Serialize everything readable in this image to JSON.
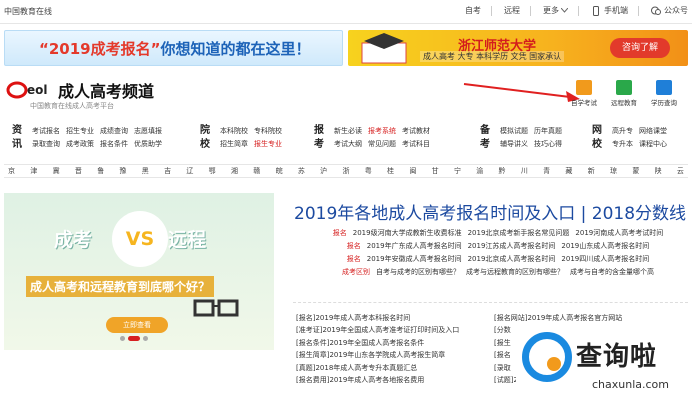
{
  "topbar": {
    "site": "中国教育在线",
    "links": [
      "自考",
      "远程",
      "更多"
    ],
    "mobile": "手机端",
    "wechat": "公众号"
  },
  "banners": {
    "left": {
      "pre": "“2019成考报名”",
      "post": "你想知道的都在这里！"
    },
    "right": {
      "title": "浙江师范大学",
      "sub": "成人高考 大专 本科学历 文凭 国家承认",
      "button": "咨询了解"
    }
  },
  "header": {
    "logo": "eol",
    "title": "成人高考频道",
    "subtitle": "中国教育在线成人高考平台",
    "icons": [
      {
        "label": "自学考试"
      },
      {
        "label": "远程教育"
      },
      {
        "label": "学历查询"
      }
    ]
  },
  "categories": [
    {
      "head": [
        "资",
        "讯"
      ],
      "rows": [
        [
          "考试报名",
          "招生专业",
          "成绩查询",
          "志愿填报"
        ],
        [
          "录取查询",
          "成考政策",
          "报名条件",
          "优质助学"
        ]
      ]
    },
    {
      "head": [
        "院",
        "校"
      ],
      "rows": [
        [
          "本科院校",
          "专科院校"
        ],
        [
          "招生简章",
          "报生专业"
        ]
      ]
    },
    {
      "head": [
        "报",
        "考"
      ],
      "rows": [
        [
          "新生必读",
          "报考系统",
          "考试教材"
        ],
        [
          "考试大纲",
          "常见问题",
          "考试科目"
        ]
      ]
    },
    {
      "head": [
        "备",
        "考"
      ],
      "rows": [
        [
          "模拟试题",
          "历年真题"
        ],
        [
          "辅导讲义",
          "技巧心得"
        ]
      ]
    },
    {
      "head": [
        "网",
        "校"
      ],
      "rows": [
        [
          "高升专",
          "网络课堂"
        ],
        [
          "专升本",
          "课程中心"
        ]
      ]
    }
  ],
  "provinces": [
    "京",
    "津",
    "冀",
    "晋",
    "鲁",
    "豫",
    "黑",
    "吉",
    "辽",
    "鄂",
    "湘",
    "赣",
    "皖",
    "苏",
    "沪",
    "浙",
    "粤",
    "桂",
    "闽",
    "甘",
    "宁",
    "渝",
    "黔",
    "川",
    "青",
    "藏",
    "新",
    "琼",
    "蒙",
    "陕",
    "云"
  ],
  "promo": {
    "a": "成考",
    "vs": "VS",
    "b": "远程",
    "question": "成人高考和远程教育到底哪个好？",
    "button": "立即查看"
  },
  "headline": "2019年各地成人高考报名时间及入口 | 2018分数线",
  "news": [
    [
      "报名",
      "2019级河南大学成教新生收费标准",
      "2019北京成考新手报名常见问题",
      "2019河南成人高考考试时间"
    ],
    [
      "报名",
      "2019年广东成人高考报名时间",
      "2019江苏成人高考报名时间",
      "2019山东成人高考报名时间"
    ],
    [
      "报名",
      "2019年安徽成人高考报名时间",
      "2019北京成人高考报名时间",
      "2019四川成人高考报名时间"
    ],
    [
      "成考区别",
      "自考与成考的区别有哪些？",
      "成考与远程教育的区别有哪些？",
      "成考与自考的含金量哪个高"
    ]
  ],
  "list_left": [
    "[报名]2019年成人高考本科报名时间",
    "[准考证]2019年全国成人高考准考证打印时间及入口",
    "[报名条件]2019年全国成人高考报名条件",
    "[报生简章]2019年山东各学院成人高考报生简章",
    "[真题]2018年成人高考专升本真题汇总",
    "[报名费用]2019年成人高考各地报名费用"
  ],
  "list_right": [
    "[报名网站]2019年成人高考报名官方网站",
    "[分数",
    "[报生",
    "[报名",
    "[录取",
    "[试题]2019年成人高考时候辅导资料"
  ],
  "watermark": {
    "text": "查询啦",
    "url": "chaxunla.com"
  }
}
